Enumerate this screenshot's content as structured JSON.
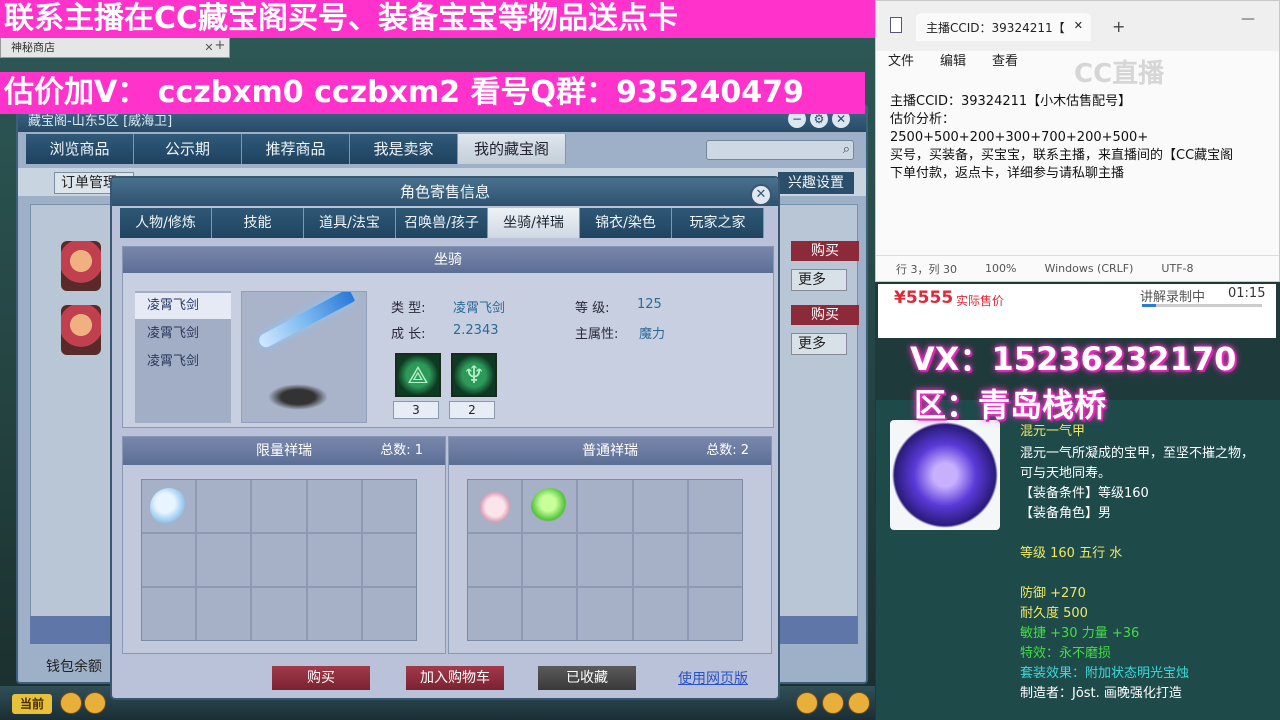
{
  "overlay": {
    "top_banner": "联系主播在CC藏宝阁买号、装备宝宝等物品送点卡",
    "second_banner": "估价加V： cczbxm0  cczbxm2  看号Q群：935240479",
    "vx": "VX：15236232170",
    "region": "区：青岛栈桥"
  },
  "client": {
    "tab": "神秘商店",
    "tab_close": "✕",
    "add": "+"
  },
  "store": {
    "title": "藏宝阁-山东5区 [威海卫]",
    "tabs": [
      "浏览商品",
      "公示期",
      "推荐商品",
      "我是卖家",
      "我的藏宝阁"
    ],
    "order_mgmt": "订单管理",
    "interest": "兴趣设置",
    "buy": "购买",
    "more": "更多",
    "wallet": "钱包余额",
    "taskbar_current": "当前"
  },
  "dialog": {
    "title": "角色寄售信息",
    "close": "✕",
    "tabs": [
      "人物/修炼",
      "技能",
      "道具/法宝",
      "召唤兽/孩子",
      "坐骑/祥瑞",
      "锦衣/染色",
      "玩家之家"
    ],
    "mount_header": "坐骑",
    "mount_list": [
      "凌霄飞剑",
      "凌霄飞剑",
      "凌霄飞剑"
    ],
    "type_label": "类    型:",
    "type_value": "凌霄飞剑",
    "level_label": "等    级:",
    "level_value": "125",
    "growth_label": "成    长:",
    "growth_value": "2.2343",
    "main_attr_label": "主属性:",
    "main_attr_value": "魔力",
    "skill_counts": [
      "3",
      "2"
    ],
    "limited_title": "限量祥瑞",
    "limited_total": "总数:  1",
    "normal_title": "普通祥瑞",
    "normal_total": "总数:  2",
    "buy": "购买",
    "add_cart": "加入购物车",
    "favorited": "已收藏",
    "web": "使用网页版"
  },
  "notepad": {
    "tab_title": "主播CCID：39324211【",
    "tab_close": "✕",
    "add": "+",
    "minimize": "—",
    "watermark": "CC直播",
    "menu": [
      "文件",
      "编辑",
      "查看"
    ],
    "lines": [
      "主播CCID：39324211【小木估售配号】",
      "估价分析：",
      "2500+500+200+300+700+200+500+",
      "买号，买装备，买宝宝，联系主播，来直播间的【CC藏宝阁",
      "下单付款，返点卡，详细参与请私聊主播"
    ],
    "status": [
      "行 3，列 30",
      "100%",
      "Windows (CRLF)",
      "UTF-8"
    ]
  },
  "price_bar": {
    "price": "¥5555",
    "price_label": "实际售价",
    "recording_label": "讲解录制中",
    "recording_time": "01:15",
    "recording_progress": 0.12
  },
  "item": {
    "name": "混元一气甲",
    "desc1": "混元一气所凝成的宝甲，至坚不摧之物，",
    "desc2": "可与天地同寿。",
    "req_level": "【装备条件】等级160",
    "req_gender": "【装备角色】男",
    "level_element": "等级 160  五行 水",
    "defense": "防御 +270",
    "durability": "耐久度 500",
    "agility": "敏捷 +30  力量 +36",
    "special": "特效：永不磨损",
    "set_effect": "套装效果：附加状态明光宝烛",
    "maker": "制造者：Jōst. 画晚强化打造"
  },
  "colors": {
    "banner": "#ff33cc",
    "price": "#e0283a",
    "tooltip_bg": "#1e4a4a"
  }
}
